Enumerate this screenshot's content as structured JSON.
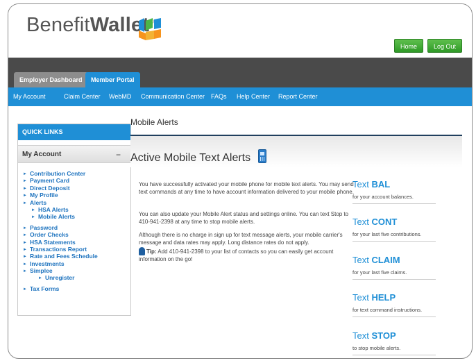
{
  "brand": {
    "name_light": "Benefit",
    "name_bold": "Wallet",
    "reg": "®",
    "colors": {
      "green": "#4cb648",
      "blue": "#1f8fd6",
      "orange": "#f7941d"
    }
  },
  "header": {
    "home_label": "Home",
    "logout_label": "Log Out"
  },
  "tabs": [
    {
      "label": "Employer Dashboard",
      "active": false
    },
    {
      "label": "Member Portal",
      "active": true
    }
  ],
  "nav": [
    "My Account",
    "Claim Center",
    "WebMD",
    "Communication Center",
    "FAQs",
    "Help Center",
    "Report Center"
  ],
  "sidebar": {
    "quick_links": "QUICK LINKS",
    "section_title": "My Account",
    "section_toggle": "−",
    "links": [
      {
        "label": "Contribution Center",
        "level": 0
      },
      {
        "label": "Payment Card",
        "level": 0
      },
      {
        "label": "Direct Deposit",
        "level": 0
      },
      {
        "label": "My Profile",
        "level": 0
      },
      {
        "label": "Alerts",
        "level": 0
      },
      {
        "label": "HSA Alerts",
        "level": 1
      },
      {
        "label": "Mobile Alerts",
        "level": 1
      },
      {
        "label": "Password",
        "level": 0
      },
      {
        "label": "Order Checks",
        "level": 0
      },
      {
        "label": "HSA Statements",
        "level": 0
      },
      {
        "label": "Transactions Report",
        "level": 0
      },
      {
        "label": "Rate and Fees Schedule",
        "level": 0
      },
      {
        "label": "Investments",
        "level": 0
      },
      {
        "label": "Simplee",
        "level": 0
      },
      {
        "label": "Unregister",
        "level": 2
      },
      {
        "label": "Tax Forms",
        "level": 0
      }
    ]
  },
  "main": {
    "page_title": "Mobile Alerts",
    "section_title": "Active Mobile Text Alerts",
    "para1": "You have successfully activated your mobile phone for mobile text alerts. You may send text commands at any time to have account information delivered to your mobile phone.",
    "para2": "You can also update your Mobile Alert status and settings online. You can text Stop to 410-941-2398 at any time to stop mobile alerts.",
    "para3": "Although there is no charge in sign up for text message alerts, your mobile carrier's message and data rates may apply. Long distance rates do not apply.",
    "tip_label": "Tip:",
    "tip_text": " Add 410-941-2398 to your list of contacts so you can easily get account information on the go!"
  },
  "commands": [
    {
      "prefix": "Text ",
      "keyword": "BAL",
      "desc": "for your account balances."
    },
    {
      "prefix": "Text ",
      "keyword": "CONT",
      "desc": "for your last five contributions."
    },
    {
      "prefix": "Text ",
      "keyword": "CLAIM",
      "desc": "for your last five claims."
    },
    {
      "prefix": "Text ",
      "keyword": "HELP",
      "desc": "for text command instructions."
    },
    {
      "prefix": "Text ",
      "keyword": "STOP",
      "desc": "to stop mobile alerts."
    }
  ]
}
